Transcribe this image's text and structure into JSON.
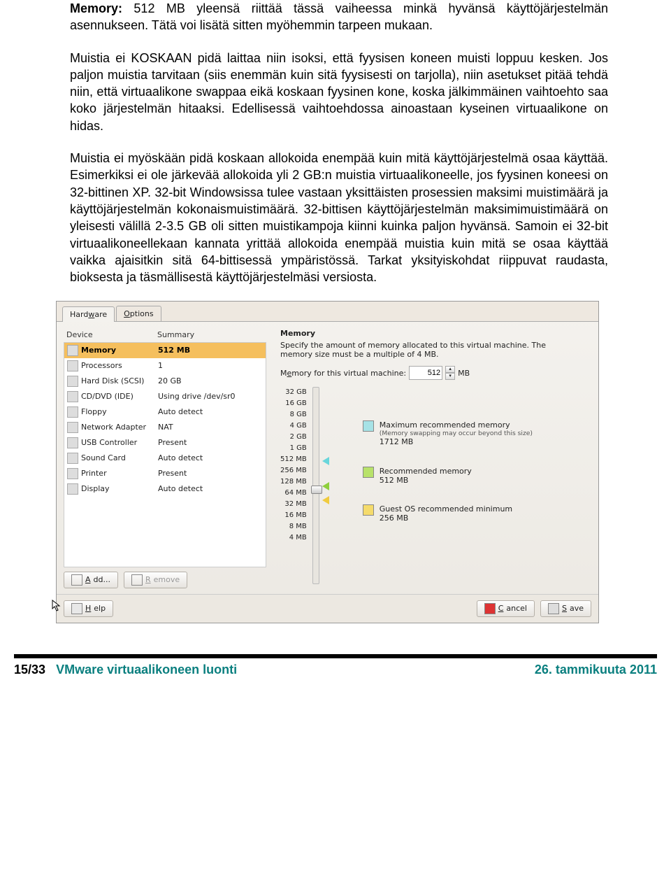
{
  "doc": {
    "p1_bold": "Memory:",
    "p1_rest": " 512 MB yleensä riittää tässä vaiheessa minkä hyvänsä käyttöjärjestelmän asennukseen. Tätä voi lisätä sitten myöhemmin tarpeen mukaan.",
    "p2": "Muistia ei KOSKAAN pidä laittaa niin isoksi, että fyysisen koneen muisti loppuu kesken. Jos paljon muistia tarvitaan (siis enemmän kuin sitä fyysisesti on tarjolla), niin asetukset pitää tehdä niin, että virtuaalikone swappaa eikä koskaan fyysinen kone, koska jälkimmäinen vaihtoehto saa koko järjestelmän hitaaksi. Edellisessä vaihtoehdossa ainoastaan kyseinen virtuaalikone on hidas.",
    "p3": "Muistia ei myöskään pidä koskaan allokoida enempää kuin mitä käyttöjärjestelmä osaa käyttää. Esimerkiksi ei ole järkevää allokoida yli 2 GB:n muistia virtuaalikoneelle, jos fyysinen koneesi on 32-bittinen XP. 32-bit Windowsissa tulee vastaan yksittäisten prosessien maksimi muistimäärä ja käyttöjärjestelmän kokonaismuistimäärä. 32-bittisen käyttöjärjestelmän maksimimuistimäärä on yleisesti välillä 2-3.5 GB oli sitten muistikampoja kiinni kuinka paljon hyvänsä. Samoin ei 32-bit virtuaalikoneellekaan kannata yrittää allokoida enempää muistia kuin mitä se osaa käyttää vaikka ajaisitkin sitä 64-bittisessä ympäristössä. Tarkat yksityiskohdat riippuvat raudasta, bioksesta ja täsmällisestä käyttöjärjestelmäsi versiosta."
  },
  "screenshot": {
    "tabs": {
      "hardware": "Hardware",
      "options": "Options"
    },
    "table": {
      "h_device": "Device",
      "h_summary": "Summary",
      "rows": [
        {
          "name": "Memory",
          "summary": "512 MB"
        },
        {
          "name": "Processors",
          "summary": "1"
        },
        {
          "name": "Hard Disk (SCSI)",
          "summary": "20 GB"
        },
        {
          "name": "CD/DVD (IDE)",
          "summary": "Using drive /dev/sr0"
        },
        {
          "name": "Floppy",
          "summary": "Auto detect"
        },
        {
          "name": "Network Adapter",
          "summary": "NAT"
        },
        {
          "name": "USB Controller",
          "summary": "Present"
        },
        {
          "name": "Sound Card",
          "summary": "Auto detect"
        },
        {
          "name": "Printer",
          "summary": "Present"
        },
        {
          "name": "Display",
          "summary": "Auto detect"
        }
      ]
    },
    "buttons": {
      "add": "Add...",
      "remove": "Remove",
      "help": "Help",
      "cancel": "Cancel",
      "save": "Save"
    },
    "right": {
      "title": "Memory",
      "desc": "Specify the amount of memory allocated to this virtual machine. The memory size must be a multiple of 4 MB.",
      "label": "Memory for this virtual machine:",
      "value": "512",
      "unit": "MB",
      "ticks": [
        "32 GB",
        "16 GB",
        "8 GB",
        "4 GB",
        "2 GB",
        "1 GB",
        "512 MB",
        "256 MB",
        "128 MB",
        "64 MB",
        "32 MB",
        "16 MB",
        "8 MB",
        "4 MB"
      ],
      "legend": {
        "max_title": "Maximum recommended memory",
        "max_note": "(Memory swapping may occur beyond this size)",
        "max_val": "1712 MB",
        "rec_title": "Recommended memory",
        "rec_val": "512 MB",
        "min_title": "Guest OS recommended minimum",
        "min_val": "256 MB"
      }
    }
  },
  "footer": {
    "page": "15/33",
    "title": "VMware virtuaalikoneen luonti",
    "date": "26. tammikuuta 2011"
  }
}
